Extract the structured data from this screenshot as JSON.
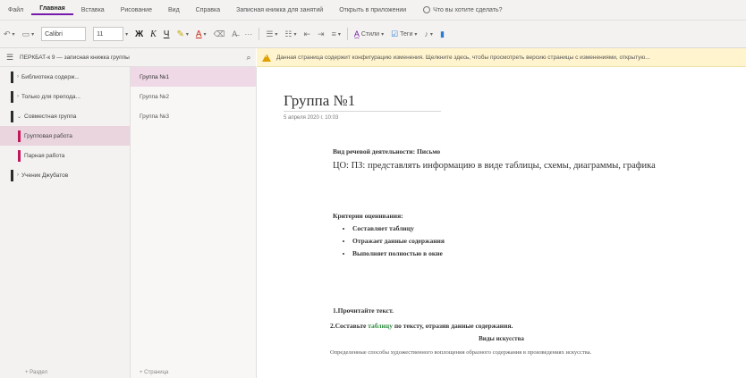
{
  "menu": {
    "tabs": [
      "Файл",
      "Главная",
      "Вставка",
      "Рисование",
      "Вид",
      "Справка",
      "Записная книжка для занятий",
      "Открыть в приложении"
    ],
    "active_index": 1,
    "tell_me": "Что вы хотите сделать?"
  },
  "toolbar": {
    "font_name": "Calibri",
    "font_size": "11",
    "styles_label": "Стили",
    "tags_label": "Теги"
  },
  "nav": {
    "notebook_name": "ПЕРКБАТ-к 9 — записная книжка группы",
    "sections": [
      {
        "label": "Библиотека содерж..."
      },
      {
        "label": "Только для препода..."
      },
      {
        "label": "Совместная группа"
      },
      {
        "label": "Групповая работа"
      },
      {
        "label": "Парная работа"
      },
      {
        "label": "Ученик Джубатов"
      }
    ],
    "pages": [
      "Группа №1",
      "Группа №2",
      "Группа №3"
    ],
    "sections_footer": "+ Раздел",
    "pages_footer": "+ Страница"
  },
  "infobar": {
    "text": "Данная страница содержит конфигурацию изменения. Щелкните здесь, чтобы просмотреть версию страницы с изменениями, открытую..."
  },
  "page": {
    "title": "Группа №1",
    "date": "5 апреля 2020 г.   10:03",
    "line1": "Вид речевой деятельности: Письмо",
    "line2": "ЦО: ПЗ: представлять информацию в виде таблицы, схемы, диаграммы, графика",
    "line3": "Критерии оценивания:",
    "bullets": [
      "Составляет таблицу",
      "Отражает данные содержания",
      "Выполняет полностью в окне"
    ],
    "line4": "1.Прочитайте текст.",
    "line5_pre": "2.Составьте ",
    "line5_green": "таблицу",
    "line5_post": " по тексту, отразив данные содержания.",
    "line6": "Виды искусства",
    "line7": "Определенные способы художественного воплощения  образного содержания в произведениях искусства."
  }
}
